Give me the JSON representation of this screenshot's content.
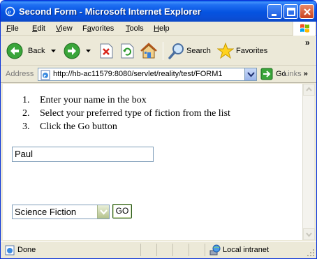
{
  "window": {
    "title": "Second Form - Microsoft Internet Explorer"
  },
  "menu": {
    "items": [
      {
        "label": "File",
        "key": "F",
        "rest": "ile"
      },
      {
        "label": "Edit",
        "key": "E",
        "rest": "dit"
      },
      {
        "label": "View",
        "key": "V",
        "rest": "iew"
      },
      {
        "label": "Favorites",
        "key": "a",
        "pre": "F",
        "rest": "vorites"
      },
      {
        "label": "Tools",
        "key": "T",
        "rest": "ools"
      },
      {
        "label": "Help",
        "key": "H",
        "rest": "elp"
      }
    ]
  },
  "toolbar": {
    "back_label": "Back",
    "search_label": "Search",
    "favorites_label": "Favorites",
    "chevron": "»"
  },
  "address": {
    "label": "Address",
    "url": "http://hb-ac11579:8080/servlet/reality/test/FORM1",
    "go_label": "Go",
    "links_label": "Links",
    "links_chevron": "»"
  },
  "page": {
    "instructions": [
      {
        "num": "1.",
        "text": "Enter your name in the box"
      },
      {
        "num": "2.",
        "text": "Select your preferred type of fiction from the list"
      },
      {
        "num": "3.",
        "text": "Click the Go button"
      }
    ],
    "name_value": "Paul",
    "fiction_selected": "Science Fiction",
    "submit_label": "GO"
  },
  "status": {
    "text": "Done",
    "zone": "Local intranet"
  },
  "colors": {
    "titlebar": "#0553e0",
    "window_frame": "#ece9d8",
    "address_border": "#7f9db9"
  }
}
